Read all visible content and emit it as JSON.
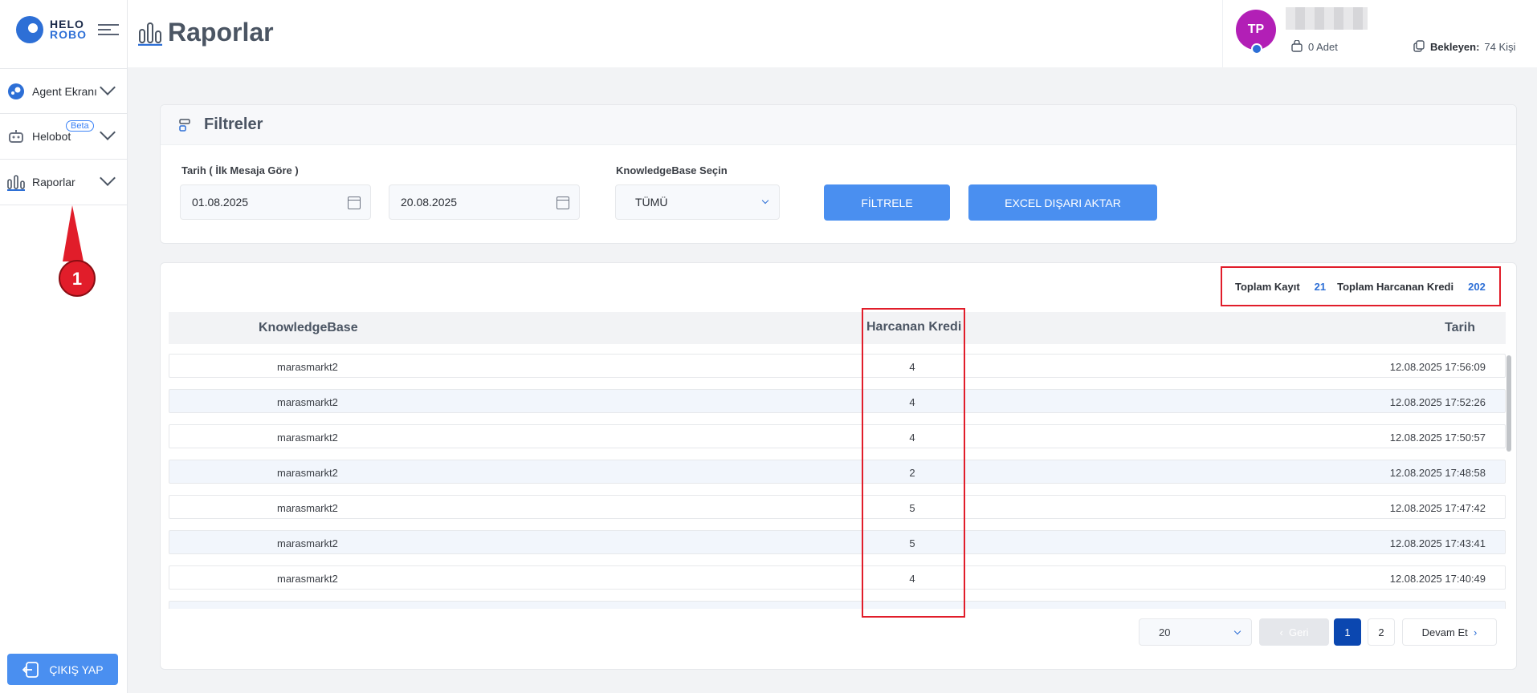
{
  "brand": {
    "line1": "HELO",
    "line2": "ROBO"
  },
  "page_title": "Raporlar",
  "sidebar": {
    "items": [
      {
        "label": "Agent Ekranı"
      },
      {
        "label": "Helobot",
        "badge": "Beta"
      },
      {
        "label": "Raporlar"
      }
    ],
    "annotation_number": "1",
    "logout_label": "ÇIKIŞ YAP"
  },
  "header": {
    "avatar_initials": "TP",
    "count_text": "0 Adet",
    "waiting_label": "Bekleyen:",
    "waiting_value": "74 Kişi"
  },
  "filters": {
    "title": "Filtreler",
    "date_label": "Tarih ( İlk Mesaja Göre )",
    "date_start": "01.08.2025",
    "date_end": "20.08.2025",
    "kb_label": "KnowledgeBase Seçin",
    "kb_value": "TÜMÜ",
    "filter_button": "FİLTRELE",
    "export_button": "EXCEL DIŞARI AKTAR"
  },
  "totals": {
    "records_label": "Toplam Kayıt",
    "records_value": "21",
    "credit_label": "Toplam Harcanan Kredi",
    "credit_value": "202"
  },
  "table": {
    "headers": [
      "KnowledgeBase",
      "Harcanan Kredi",
      "Tarih"
    ],
    "rows": [
      [
        "marasmarkt2",
        "4",
        "12.08.2025 17:56:09"
      ],
      [
        "marasmarkt2",
        "4",
        "12.08.2025 17:52:26"
      ],
      [
        "marasmarkt2",
        "4",
        "12.08.2025 17:50:57"
      ],
      [
        "marasmarkt2",
        "2",
        "12.08.2025 17:48:58"
      ],
      [
        "marasmarkt2",
        "5",
        "12.08.2025 17:47:42"
      ],
      [
        "marasmarkt2",
        "5",
        "12.08.2025 17:43:41"
      ],
      [
        "marasmarkt2",
        "4",
        "12.08.2025 17:40:49"
      ]
    ]
  },
  "pagination": {
    "page_size": "20",
    "prev_label": "Geri",
    "pages": [
      "1",
      "2"
    ],
    "current_page": "1",
    "next_label": "Devam Et"
  },
  "colors": {
    "accent": "#4a8ff0",
    "highlight": "#e11d2a",
    "avatar": "#b21fb6"
  }
}
